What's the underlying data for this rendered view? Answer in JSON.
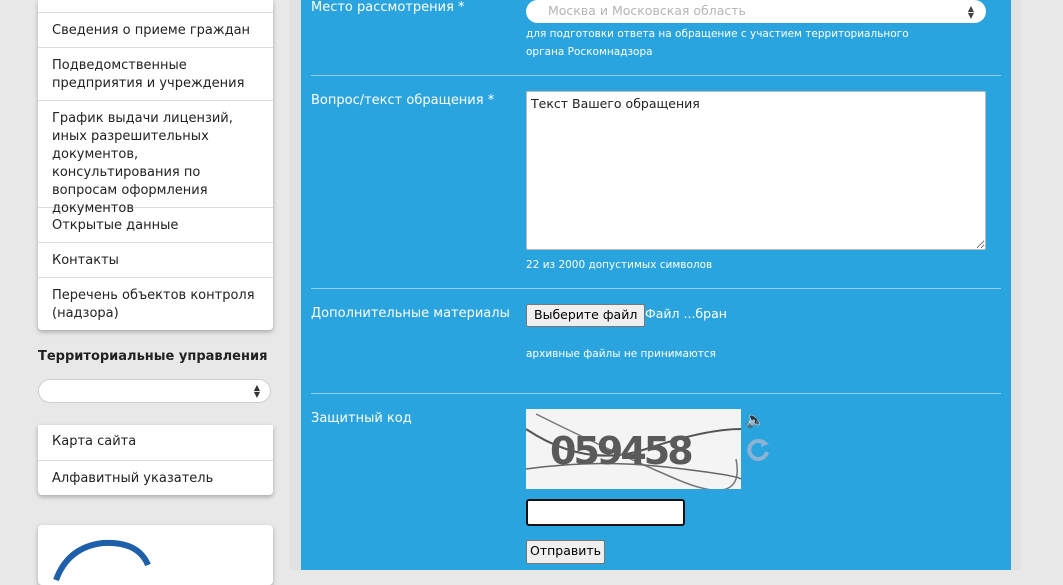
{
  "sidebar": {
    "menu": [
      "Сведения о приеме граждан",
      "Подведомственные предприятия и учреждения",
      "График выдачи лицензий, иных разрешительных документов, консультирования по вопросам оформления документов",
      "Открытые данные",
      "Контакты",
      "Перечень объектов контроля (надзора)"
    ],
    "territorial_title": "Территориальные управления",
    "footer_links": [
      "Карта сайта",
      "Алфавитный указатель"
    ]
  },
  "form": {
    "place": {
      "label": "Место рассмотрения *",
      "value": "Москва и Московская область",
      "hint": "для подготовки ответа на обращение с участием территориального органа Роскомнадзора"
    },
    "question": {
      "label": "Вопрос/текст обращения *",
      "value": "Текст Вашего обращения",
      "counter": "22 из 2000 допустимых символов"
    },
    "attachments": {
      "label": "Дополнительные материалы",
      "button": "Выберите файл",
      "filename": "Файл ...бран",
      "hint": "архивные файлы не принимаются"
    },
    "captcha": {
      "label": "Защитный код",
      "code": "059458"
    },
    "submit": "Отправить"
  }
}
